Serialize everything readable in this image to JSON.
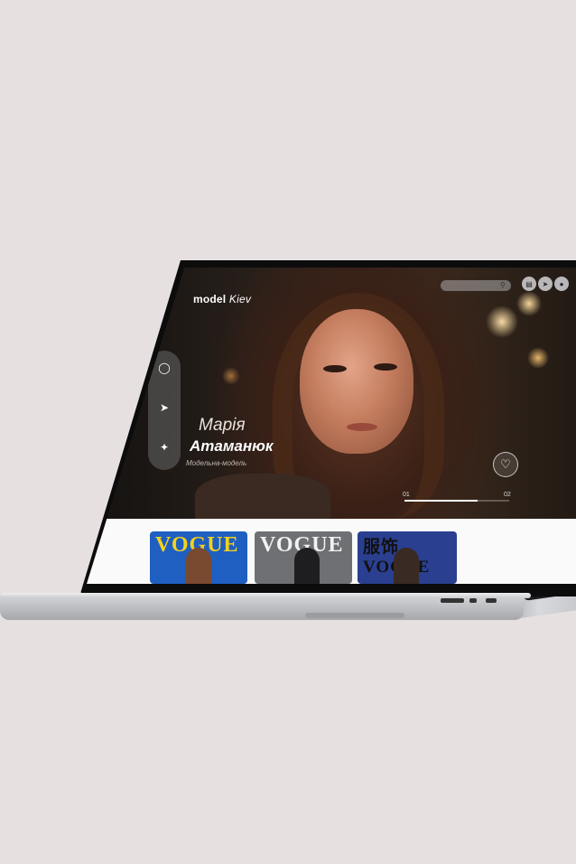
{
  "header": {
    "logo_bold": "model",
    "logo_light": "Kiev",
    "nav_icons": [
      "folder-icon",
      "send-icon",
      "user-icon"
    ]
  },
  "search": {
    "placeholder": ""
  },
  "social": {
    "items": [
      "instagram-icon",
      "telegram-icon",
      "twitter-icon"
    ]
  },
  "hero": {
    "first_name": "Марія",
    "last_name": "Атаманюк",
    "role": "Модельна-модель"
  },
  "slider": {
    "current": "01",
    "total": "02",
    "progress": 0.7
  },
  "covers": [
    {
      "masthead": "VOGUE",
      "bg": "#1f5fc2",
      "text": "#f3d21a"
    },
    {
      "masthead": "VOGUE",
      "bg": "#6e7073",
      "text": "#f2f2f2"
    },
    {
      "masthead": "服饰VOGUE",
      "bg": "#2a3f8f",
      "text": "#111111"
    }
  ],
  "colors": {
    "background": "#e7e0e1",
    "accent": "#ffffff"
  }
}
